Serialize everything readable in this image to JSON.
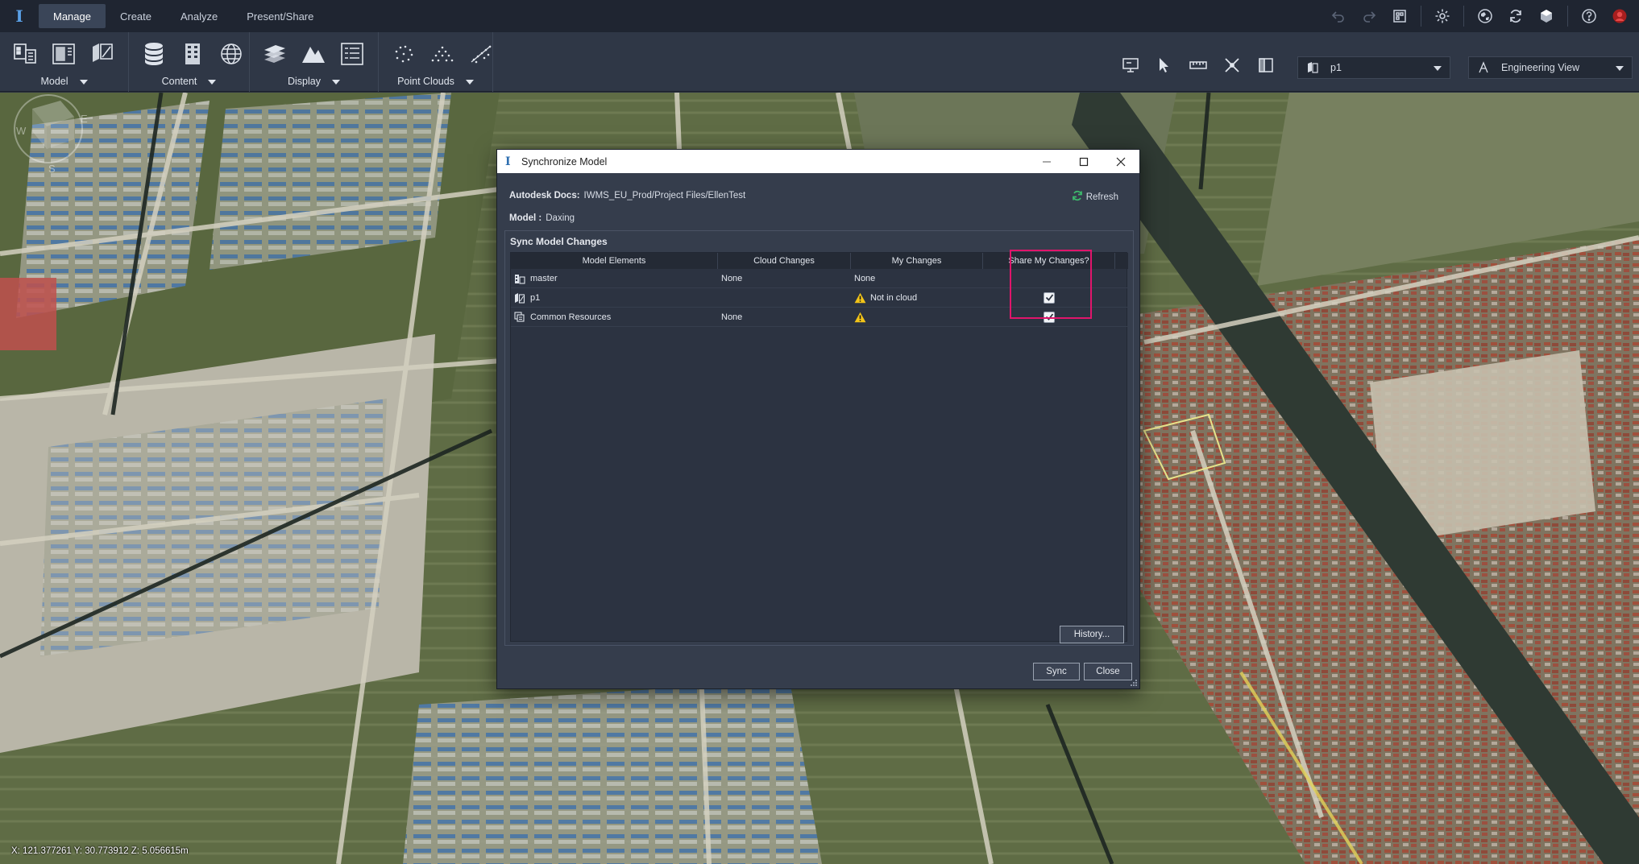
{
  "app": {
    "logo_glyph": "I",
    "menu_tabs": [
      "Manage",
      "Create",
      "Analyze",
      "Present/Share"
    ],
    "active_tab": "Manage",
    "menu_icons": [
      "undo-icon",
      "redo-icon",
      "workspace-icon",
      "settings-icon",
      "globe-icon",
      "sync-icon",
      "model-cube-icon",
      "help-icon",
      "user-avatar-icon"
    ]
  },
  "ribbon": {
    "groups": [
      {
        "label": "Model",
        "icons": [
          "model-properties-icon",
          "model-view-icon",
          "model-layers-icon"
        ]
      },
      {
        "label": "Content",
        "icons": [
          "data-sources-icon",
          "buildings-icon",
          "globe-mesh-icon"
        ]
      },
      {
        "label": "Display",
        "icons": [
          "layers-stack-icon",
          "terrain-icon",
          "style-list-icon"
        ]
      },
      {
        "label": "Point Clouds",
        "icons": [
          "point-cloud-icon",
          "point-cloud-terrain-icon",
          "point-cloud-slope-icon"
        ]
      }
    ],
    "tool_icons": [
      "presentation-icon",
      "select-pointer-icon",
      "measure-icon",
      "snap-tools-icon",
      "panel-icon"
    ],
    "proposal_select": {
      "value": "p1"
    },
    "view_select": {
      "value": "Engineering View"
    }
  },
  "map": {
    "coordinates": "X: 121.377261 Y: 30.773912 Z: 5.056615m"
  },
  "dialog": {
    "title": "Synchronize Model",
    "docs_label": "Autodesk Docs:",
    "docs_path": "IWMS_EU_Prod/Project Files/EllenTest",
    "model_label": "Model :",
    "model_value": "Daxing",
    "refresh_label": "Refresh",
    "section_title": "Sync Model Changes",
    "columns": [
      "Model Elements",
      "Cloud Changes",
      "My Changes",
      "Share My Changes?"
    ],
    "rows": [
      {
        "element": "master",
        "icon": "master-model-icon",
        "cloud": "None",
        "mine": "None",
        "mine_warning": false,
        "share": null
      },
      {
        "element": "p1",
        "icon": "proposal-icon",
        "cloud": "",
        "mine": "Not in cloud",
        "mine_warning": true,
        "share": true
      },
      {
        "element": "Common Resources",
        "icon": "common-resources-icon",
        "cloud": "None",
        "mine": "",
        "mine_warning": true,
        "share": true
      }
    ],
    "history_label": "History...",
    "sync_label": "Sync",
    "close_label": "Close"
  },
  "colors": {
    "menubar": "#1f2531",
    "ribbon": "#2f3746",
    "dialog_body": "#353d4c",
    "highlight": "#e0156b",
    "warning": "#f2c418",
    "refresh_green": "#3dba6c"
  }
}
